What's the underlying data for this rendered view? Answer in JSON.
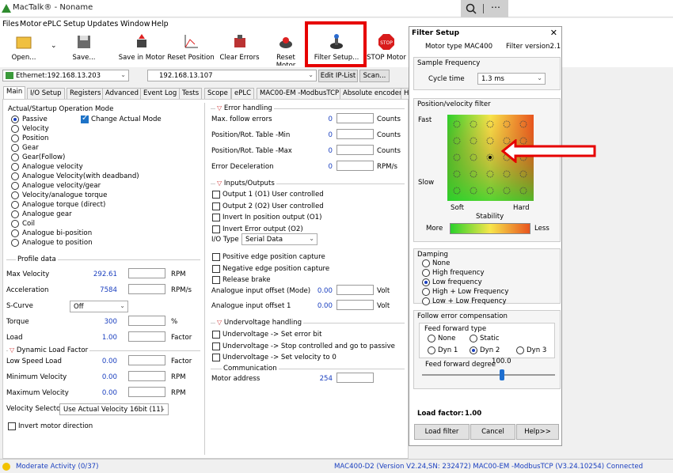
{
  "app": {
    "title": "MacTalk® - Noname"
  },
  "menu": [
    "Files",
    "Motor",
    "ePLC",
    "Setup",
    "Updates",
    "Window",
    "Help"
  ],
  "toolbar": {
    "open": "Open...",
    "save": "Save...",
    "save_in_motor": "Save in Motor",
    "reset_position": "Reset Position",
    "clear_errors": "Clear Errors",
    "reset_motor": "Reset Motor",
    "filter_setup": "Filter Setup...",
    "stop_motor": "STOP Motor"
  },
  "address": {
    "ethernet": "Ethernet:192.168.13.203",
    "ip": "192.168.13.107",
    "edit_ip": "Edit IP-List",
    "scan": "Scan..."
  },
  "tabs": [
    "Main",
    "I/O Setup",
    "Registers",
    "Advanced",
    "Event Log",
    "Tests",
    "Scope",
    "ePLC",
    "MAC00-EM -ModbusTCP",
    "Absolute encoder",
    "H"
  ],
  "operation": {
    "title": "Actual/Startup Operation Mode",
    "change_actual": "Change Actual Mode",
    "modes": [
      "Passive",
      "Velocity",
      "Position",
      "Gear",
      "Gear(Follow)",
      "Analogue velocity",
      "Analogue Velocity(with deadband)",
      "Analogue velocity/gear",
      "Velocity/analogue torque",
      "Analogue torque  (direct)",
      "Analogue gear",
      "Coil",
      "Analogue bi-position",
      "Analogue to position"
    ]
  },
  "profile": {
    "title": "Profile data",
    "rows": [
      {
        "label": "Max Velocity",
        "value": "292.61",
        "unit": "RPM"
      },
      {
        "label": "Acceleration",
        "value": "7584",
        "unit": "RPM/s"
      },
      {
        "label": "S-Curve",
        "select": "Off"
      },
      {
        "label": "Torque",
        "value": "300",
        "unit": "%"
      },
      {
        "label": "Load",
        "value": "1.00",
        "unit": "Factor"
      }
    ]
  },
  "dlf": {
    "title": "Dynamic Load Factor",
    "rows": [
      {
        "label": "Low Speed Load",
        "value": "0.00",
        "unit": "Factor"
      },
      {
        "label": "Minimum Velocity",
        "value": "0.00",
        "unit": "RPM"
      },
      {
        "label": "Maximum Velocity",
        "value": "0.00",
        "unit": "RPM"
      }
    ],
    "velocity_selector": "Velocity Selector",
    "velocity_selector_value": "Use Actual Velocity 16bit (11)",
    "invert": "Invert motor direction"
  },
  "errors": {
    "title": "Error handling",
    "rows": [
      {
        "label": "Max. follow errors",
        "value": "0",
        "unit": "Counts"
      },
      {
        "label": "Position/Rot. Table -Min",
        "value": "0",
        "unit": "Counts"
      },
      {
        "label": "Position/Rot. Table -Max",
        "value": "0",
        "unit": "Counts"
      },
      {
        "label": "Error Deceleration",
        "value": "0",
        "unit": "RPM/s"
      }
    ]
  },
  "io": {
    "title": "Inputs/Outputs",
    "checks": [
      "Output 1 (O1) User controlled",
      "Output 2 (O2) User controlled",
      "Invert In position output (O1)",
      "Invert Error output (O2)"
    ],
    "io_type": "I/O Type",
    "io_type_value": "Serial Data",
    "checks2": [
      "Positive edge position capture",
      "Negative edge position capture",
      "Release brake"
    ],
    "offset_mode": "Analogue input offset (Mode)",
    "offset_mode_value": "0.00",
    "offset1": "Analogue input offset 1",
    "offset1_value": "0.00",
    "volt": "Volt"
  },
  "uv": {
    "title": "Undervoltage handling",
    "checks": [
      "Undervoltage -> Set error bit",
      "Undervoltage -> Stop controlled and go to passive",
      "Undervoltage -> Set velocity to 0"
    ]
  },
  "comm": {
    "title": "Communication",
    "label": "Motor address",
    "value": "254"
  },
  "filter": {
    "title": "Filter Setup",
    "motor_type": "Motor type MAC400",
    "filter_version": "Filter version2.1",
    "sample": "Sample Frequency",
    "cycle": "Cycle time",
    "cycle_value": "1.3 ms",
    "pv": "Position/velocity filter",
    "fast": "Fast",
    "slow": "Slow",
    "soft": "Soft",
    "hard": "Hard",
    "stability": "Stability",
    "more": "More",
    "less": "Less",
    "damping": "Damping",
    "damping_opts": [
      "None",
      "High frequency",
      "Low frequency",
      "High + Low Frequency",
      "Low + Low Frequency"
    ],
    "fec": "Follow error compensation",
    "fft": "Feed forward type",
    "fft_opts": [
      "None",
      "Static",
      "Dyn 1",
      "Dyn 2",
      "Dyn 3"
    ],
    "ffd": "Feed forward degree",
    "ffd_value": "100.0",
    "ffd_slider": 0.6,
    "load_factor": "Load factor:",
    "load_factor_value": "1.00",
    "load_filter": "Load filter",
    "cancel": "Cancel",
    "help": "Help>>"
  },
  "status": {
    "activity": "Moderate Activity (0/37)",
    "info": "MAC400-D2 (Version V2.24,SN: 232472) MAC00-EM -ModbusTCP (V3.24.10254) Connected"
  },
  "colors": {
    "accent": "#1a3fbf",
    "highlight": "#e60000"
  }
}
